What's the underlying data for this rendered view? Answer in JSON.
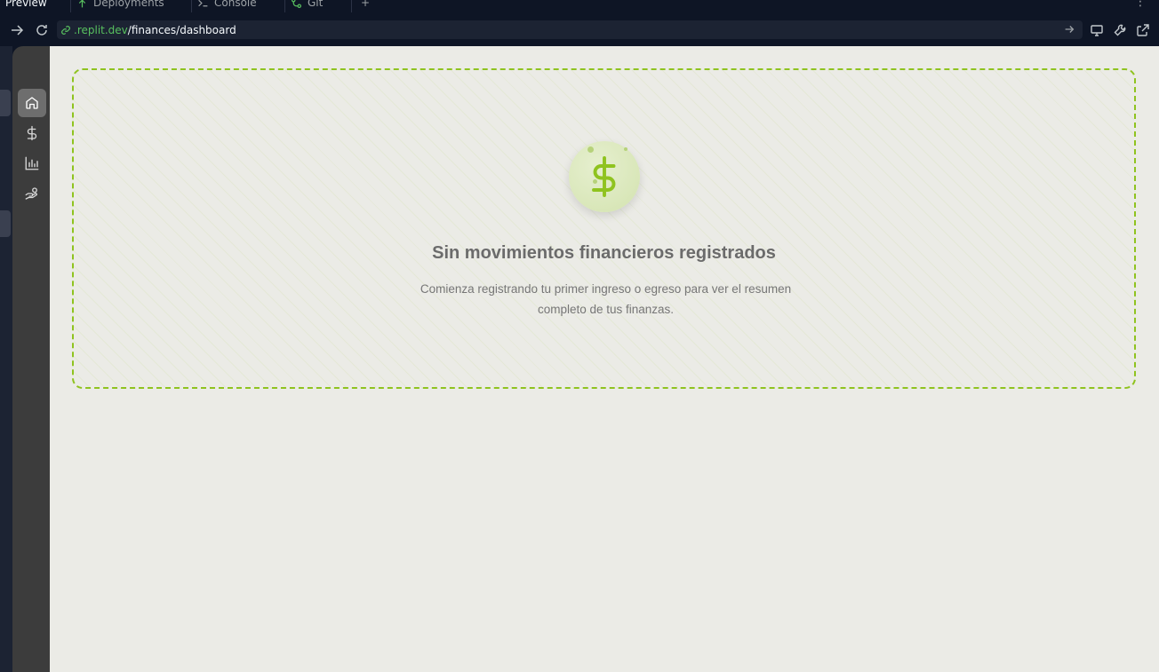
{
  "tabs": [
    {
      "label": "Preview",
      "icon": "preview-icon",
      "active": true
    },
    {
      "label": "Deployments",
      "icon": "deployments-icon",
      "active": false
    },
    {
      "label": "Console",
      "icon": "console-icon",
      "active": false
    },
    {
      "label": "Git",
      "icon": "git-icon",
      "active": false
    }
  ],
  "add_tab_label": "+",
  "menu_label": "⋮",
  "url": {
    "domain": ".replit.dev",
    "path": "/finances/dashboard"
  },
  "sidebar": {
    "items": [
      {
        "name": "home",
        "icon": "home-icon",
        "active": true
      },
      {
        "name": "finances",
        "icon": "dollar-icon",
        "active": false
      },
      {
        "name": "reports",
        "icon": "bar-chart-icon",
        "active": false
      },
      {
        "name": "payments",
        "icon": "hand-coins-icon",
        "active": false
      }
    ]
  },
  "empty_state": {
    "icon": "dollar-icon",
    "title": "Sin movimientos financieros registrados",
    "description": "Comienza registrando tu primer ingreso o egreso para ver el resumen completo de tus finanzas."
  },
  "colors": {
    "accent": "#8fc31f",
    "background": "#ebebe6",
    "sidebar": "#3c3c3c"
  }
}
